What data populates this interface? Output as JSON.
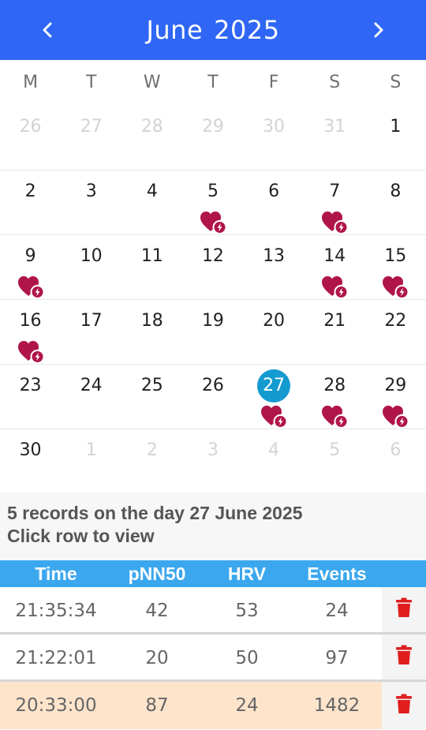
{
  "header": {
    "month": "June",
    "year": "2025",
    "prev_icon": "chevron-left-icon",
    "next_icon": "chevron-right-icon",
    "color": "#2f66f6"
  },
  "weekdays": [
    "M",
    "T",
    "W",
    "T",
    "F",
    "S",
    "S"
  ],
  "weeks": [
    [
      {
        "n": "26",
        "other": true
      },
      {
        "n": "27",
        "other": true
      },
      {
        "n": "28",
        "other": true
      },
      {
        "n": "29",
        "other": true
      },
      {
        "n": "30",
        "other": true
      },
      {
        "n": "31",
        "other": true
      },
      {
        "n": "1"
      }
    ],
    [
      {
        "n": "2"
      },
      {
        "n": "3"
      },
      {
        "n": "4"
      },
      {
        "n": "5",
        "heart": true
      },
      {
        "n": "6"
      },
      {
        "n": "7",
        "heart": true
      },
      {
        "n": "8"
      }
    ],
    [
      {
        "n": "9",
        "heart": true
      },
      {
        "n": "10"
      },
      {
        "n": "11"
      },
      {
        "n": "12"
      },
      {
        "n": "13"
      },
      {
        "n": "14",
        "heart": true
      },
      {
        "n": "15",
        "heart": true
      }
    ],
    [
      {
        "n": "16",
        "heart": true
      },
      {
        "n": "17"
      },
      {
        "n": "18"
      },
      {
        "n": "19"
      },
      {
        "n": "20"
      },
      {
        "n": "21"
      },
      {
        "n": "22"
      }
    ],
    [
      {
        "n": "23"
      },
      {
        "n": "24"
      },
      {
        "n": "25"
      },
      {
        "n": "26"
      },
      {
        "n": "27",
        "selected": true,
        "heart": true
      },
      {
        "n": "28",
        "heart": true
      },
      {
        "n": "29",
        "heart": true
      }
    ],
    [
      {
        "n": "30"
      },
      {
        "n": "1",
        "other": true
      },
      {
        "n": "2",
        "other": true
      },
      {
        "n": "3",
        "other": true
      },
      {
        "n": "4",
        "other": true
      },
      {
        "n": "5",
        "other": true
      },
      {
        "n": "6",
        "other": true
      }
    ]
  ],
  "heart_icon": "heart-lightning-icon",
  "heart_color": "#b0154a",
  "selected_color": "#139bd0",
  "info": {
    "line1": "5 records on the day 27 June 2025",
    "line2": "Click row to view"
  },
  "table": {
    "headers": [
      "Time",
      "pNN50",
      "HRV",
      "Events"
    ],
    "rows": [
      {
        "time": "21:35:34",
        "pnn50": "42",
        "hrv": "53",
        "events": "24",
        "highlighted": false
      },
      {
        "time": "21:22:01",
        "pnn50": "20",
        "hrv": "50",
        "events": "97",
        "highlighted": false
      },
      {
        "time": "20:33:00",
        "pnn50": "87",
        "hrv": "24",
        "events": "1482",
        "highlighted": true
      }
    ],
    "delete_icon": "trash-icon",
    "delete_color": "#e01e1e",
    "header_color": "#3ba7ee",
    "highlight_color": "#fde4cb"
  }
}
